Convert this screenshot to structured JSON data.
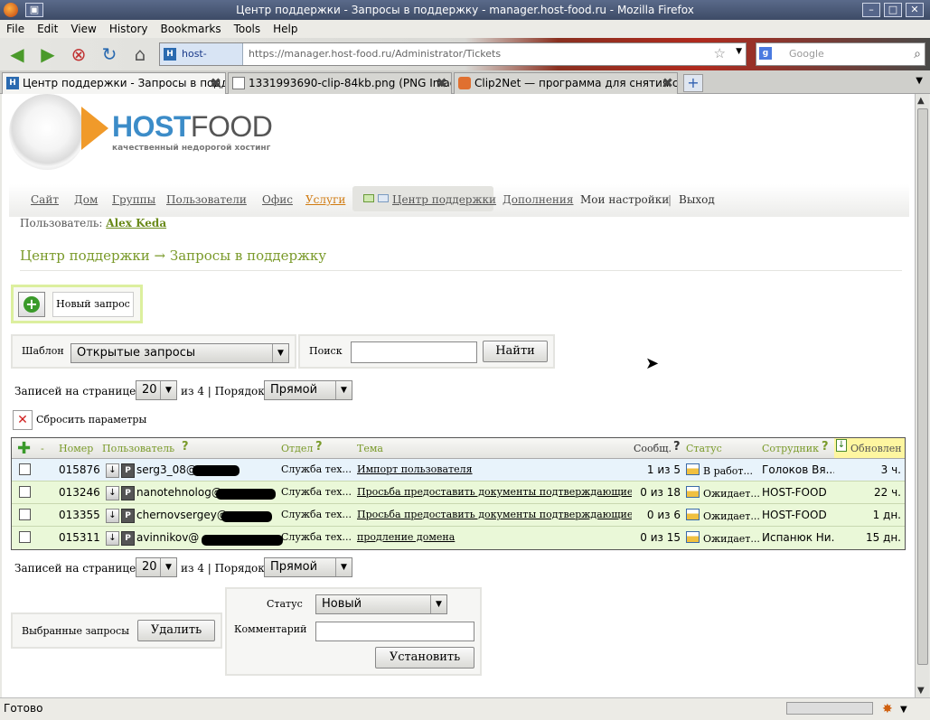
{
  "window": {
    "title": "Центр поддержки - Запросы в поддержку - manager.host-food.ru - Mozilla Firefox"
  },
  "menu": [
    "File",
    "Edit",
    "View",
    "History",
    "Bookmarks",
    "Tools",
    "Help"
  ],
  "address": {
    "site": "host-food.ru",
    "url": "https://manager.host-food.ru/Administrator/Tickets"
  },
  "search": {
    "placeholder": "Google"
  },
  "tabs": [
    {
      "label": "Центр поддержки - Запросы в подде..."
    },
    {
      "label": "1331993690-clip-84kb.png (PNG Image,..."
    },
    {
      "label": "Clip2Net — программа для снятия скр..."
    }
  ],
  "logo": {
    "brand_a": "HOST",
    "brand_b": "FOOD",
    "tagline": "качественный недорогой хостинг"
  },
  "nav": {
    "site": "Сайт",
    "home": "Дом",
    "groups": "Группы",
    "users": "Пользователи",
    "office": "Офис",
    "services": "Услуги",
    "support": "Центр поддержки",
    "addons": "Дополнения",
    "settings": "Мои настройки",
    "sep": "|",
    "exit": "Выход"
  },
  "user": {
    "label": "Пользователь:",
    "name": "Alex Keda"
  },
  "page_title": "Центр поддержки → Запросы в поддержку",
  "new_request": "Новый запрос",
  "template": {
    "label": "Шаблон",
    "value": "Открытые запросы"
  },
  "searchform": {
    "label": "Поиск",
    "button": "Найти"
  },
  "paging": {
    "per_page_label": "Записей на странице:",
    "per_page": "20",
    "of_label": "из 4 | Порядок:",
    "order": "Прямой"
  },
  "reset": "Сбросить параметры",
  "columns": {
    "dash": "-",
    "number": "Номер",
    "user": "Пользователь",
    "q": "?",
    "dept": "Отдел",
    "topic": "Тема",
    "messages": "Сообщ.",
    "status": "Статус",
    "employee": "Сотрудник",
    "updated": "Обновлен"
  },
  "rows": [
    {
      "number": "015876",
      "user": "serg3_08@",
      "dept": "Служба тех...",
      "topic": "Импорт пользователя",
      "messages": "1 из 5",
      "status": "В работ...",
      "employee": "Голоков Вя...",
      "updated": "3 ч."
    },
    {
      "number": "013246",
      "user": "nanotehnolog@",
      "dept": "Служба тех...",
      "topic": "Просьба предоставить документы подтверждающие",
      "messages": "0 из 18",
      "status": "Ожидает...",
      "employee": "HOST-FOOD",
      "updated": "22 ч."
    },
    {
      "number": "013355",
      "user": "chernovsergey@",
      "dept": "Служба тех...",
      "topic": "Просьба предоставить документы подтверждающие",
      "messages": "0 из 6",
      "status": "Ожидает...",
      "employee": "HOST-FOOD",
      "updated": "1 дн."
    },
    {
      "number": "015311",
      "user": "avinnikov@",
      "dept": "Служба тех...",
      "topic": "продление домена",
      "messages": "0 из 15",
      "status": "Ожидает...",
      "employee": "Испанюк Ни...",
      "updated": "15 дн."
    }
  ],
  "bulk": {
    "label": "Выбранные запросы",
    "delete": "Удалить"
  },
  "setstatus": {
    "status_label": "Статус",
    "status_value": "Новый",
    "comment_label": "Комментарий",
    "button": "Установить"
  },
  "statusbar": {
    "text": "Готово"
  }
}
